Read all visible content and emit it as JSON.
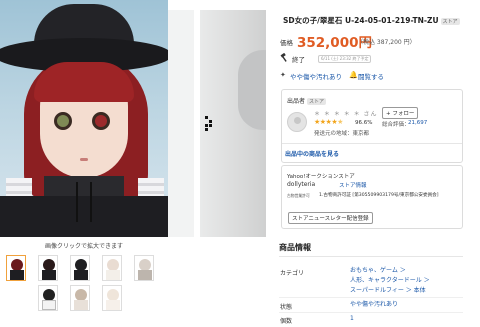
{
  "gallery": {
    "zoom_caption": "画像クリックで拡大できます",
    "thumbnail_count": 8,
    "active_thumbnail": 1
  },
  "item": {
    "title": "SD女の子/翠星石 U-24-05-01-219-TN-ZU",
    "store_badge": "ストア",
    "price_label": "価格",
    "price": "352,000円",
    "tax_note": "（税込 387,200 円）",
    "status": "終了",
    "end_date": "6/11 (土) 23:32 終了予定",
    "condition_link": "やや傷や汚れあり",
    "watch_link": "闘覧する"
  },
  "seller": {
    "heading": "出品者",
    "badge": "ストア",
    "name": "＊ ＊ ＊ ＊ ＊ さん",
    "follow_label": "+ フォロー",
    "stars": "★★★★",
    "half_star": "★",
    "score": "96.6%",
    "rating_label": "総合評価：",
    "rating_count": "21,697",
    "region": "発送元の地域：東京都",
    "items_link": "出品中の商品を見る"
  },
  "store": {
    "type": "Yahoo!オークションストア",
    "name": "dollyteria",
    "info_link": "ストア情報",
    "license_label": "古物営業許可",
    "license_value": "1.古物商許可証 [第305509903179号/東京都公安委員会]",
    "newsletter_label": "ストアニュースレター配信登録"
  },
  "product_info": {
    "title": "商品情報",
    "rows": [
      {
        "label": "カテゴリ",
        "values": [
          "おもちゃ、ゲーム ＞",
          "人形、キャラクタードール ＞",
          "スーパードルフィー ＞ 本体"
        ]
      },
      {
        "label": "状態",
        "values": [
          "やや傷や汚れあり"
        ]
      },
      {
        "label": "個数",
        "values": [
          "1"
        ]
      }
    ]
  },
  "colors": {
    "price": "#e05c24",
    "link": "#1a57a8",
    "star": "#f2a51c"
  },
  "icons": [
    "next-arrow-icon",
    "hammer-icon",
    "sparkle-icon",
    "bell-icon",
    "user-avatar-icon"
  ]
}
